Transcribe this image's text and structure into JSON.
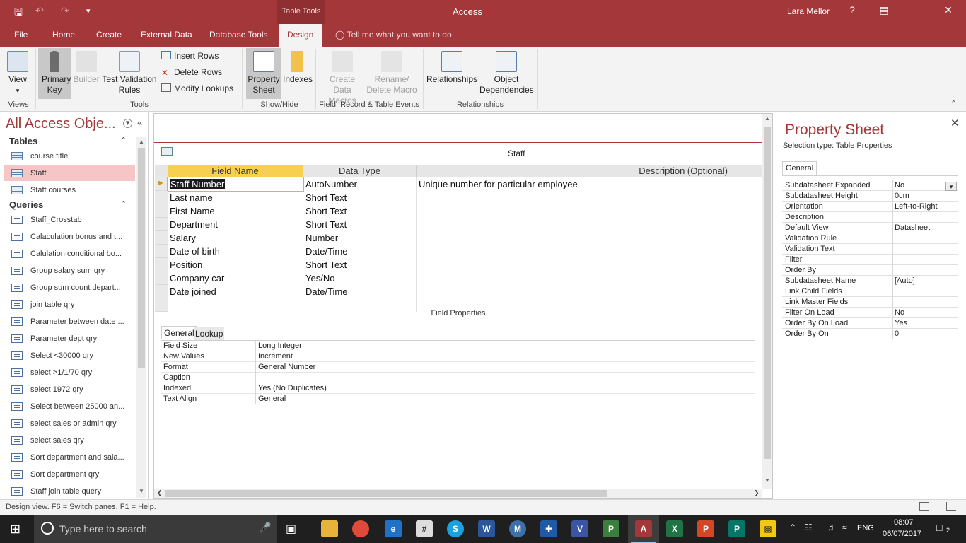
{
  "titlebar": {
    "context_tab": "Table Tools",
    "app_title": "Access",
    "user": "Lara Mellor",
    "help": "?"
  },
  "menu": {
    "items": [
      "File",
      "Home",
      "Create",
      "External Data",
      "Database Tools",
      "Design"
    ],
    "active": "Design",
    "tell_me": "Tell me what you want to do"
  },
  "ribbon": {
    "views": {
      "view": "View",
      "group": "Views"
    },
    "tools": {
      "primary_key": "Primary Key",
      "builder": "Builder",
      "test_validation": "Test Validation Rules",
      "insert_rows": "Insert Rows",
      "delete_rows": "Delete Rows",
      "modify_lookups": "Modify Lookups",
      "group": "Tools"
    },
    "showhide": {
      "property_sheet": "Property Sheet",
      "indexes": "Indexes",
      "group": "Show/Hide"
    },
    "events": {
      "create_data_macros": "Create Data Macros",
      "rename_delete_macro": "Rename/ Delete Macro",
      "group": "Field, Record & Table Events"
    },
    "relationships": {
      "relationships": "Relationships",
      "object_dependencies": "Object Dependencies",
      "group": "Relationships"
    }
  },
  "nav": {
    "title": "All Access Obje...",
    "tables_label": "Tables",
    "tables": [
      "course title",
      "Staff",
      "Staff courses"
    ],
    "selected_table": "Staff",
    "queries_label": "Queries",
    "queries": [
      "Staff_Crosstab",
      "Calaculation bonus and t...",
      "Calulation conditional bo...",
      "Group salary sum qry",
      "Group sum count depart...",
      "join table qry",
      "Parameter between date ...",
      "Parameter dept qry",
      "Select <30000 qry",
      "select >1/1/70 qry",
      "select 1972 qry",
      "Select between 25000 an...",
      "select sales or admin qry",
      "select sales qry",
      "Sort department and sala...",
      "Sort department qry",
      "Staff join table query"
    ]
  },
  "design": {
    "tab_name": "Staff",
    "headers": {
      "field_name": "Field Name",
      "data_type": "Data Type",
      "description": "Description (Optional)"
    },
    "rows": [
      {
        "field": "Staff Number",
        "type": "AutoNumber",
        "desc": "Unique number for particular employee"
      },
      {
        "field": "Last name",
        "type": "Short Text",
        "desc": ""
      },
      {
        "field": "First Name",
        "type": "Short Text",
        "desc": ""
      },
      {
        "field": "Department",
        "type": "Short Text",
        "desc": ""
      },
      {
        "field": "Salary",
        "type": "Number",
        "desc": ""
      },
      {
        "field": "Date of birth",
        "type": "Date/Time",
        "desc": ""
      },
      {
        "field": "Position",
        "type": "Short Text",
        "desc": ""
      },
      {
        "field": "Company car",
        "type": "Yes/No",
        "desc": ""
      },
      {
        "field": "Date joined",
        "type": "Date/Time",
        "desc": ""
      }
    ],
    "field_properties_label": "Field Properties",
    "fp_tabs": [
      "General",
      "Lookup"
    ],
    "field_properties": [
      {
        "name": "Field Size",
        "value": "Long Integer"
      },
      {
        "name": "New Values",
        "value": "Increment"
      },
      {
        "name": "Format",
        "value": "General Number"
      },
      {
        "name": "Caption",
        "value": ""
      },
      {
        "name": "Indexed",
        "value": "Yes (No Duplicates)"
      },
      {
        "name": "Text Align",
        "value": "General"
      }
    ]
  },
  "property_sheet": {
    "title": "Property Sheet",
    "selection_type": "Selection type:  Table Properties",
    "tab": "General",
    "rows": [
      {
        "name": "Subdatasheet Expanded",
        "value": "No"
      },
      {
        "name": "Subdatasheet Height",
        "value": "0cm"
      },
      {
        "name": "Orientation",
        "value": "Left-to-Right"
      },
      {
        "name": "Description",
        "value": ""
      },
      {
        "name": "Default View",
        "value": "Datasheet"
      },
      {
        "name": "Validation Rule",
        "value": ""
      },
      {
        "name": "Validation Text",
        "value": ""
      },
      {
        "name": "Filter",
        "value": ""
      },
      {
        "name": "Order By",
        "value": ""
      },
      {
        "name": "Subdatasheet Name",
        "value": "[Auto]"
      },
      {
        "name": "Link Child Fields",
        "value": ""
      },
      {
        "name": "Link Master Fields",
        "value": ""
      },
      {
        "name": "Filter On Load",
        "value": "No"
      },
      {
        "name": "Order By On Load",
        "value": "Yes"
      },
      {
        "name": "Order By On",
        "value": "0"
      }
    ]
  },
  "status": {
    "text": "Design view.  F6 = Switch panes.  F1 = Help."
  },
  "taskbar": {
    "search_placeholder": "Type here to search",
    "lang": "ENG",
    "time": "08:07",
    "date": "06/07/2017",
    "notifications": "2"
  },
  "colors": {
    "accent": "#a4373a",
    "selected_nav": "#f6c5c6",
    "field_header": "#f7d04f"
  }
}
